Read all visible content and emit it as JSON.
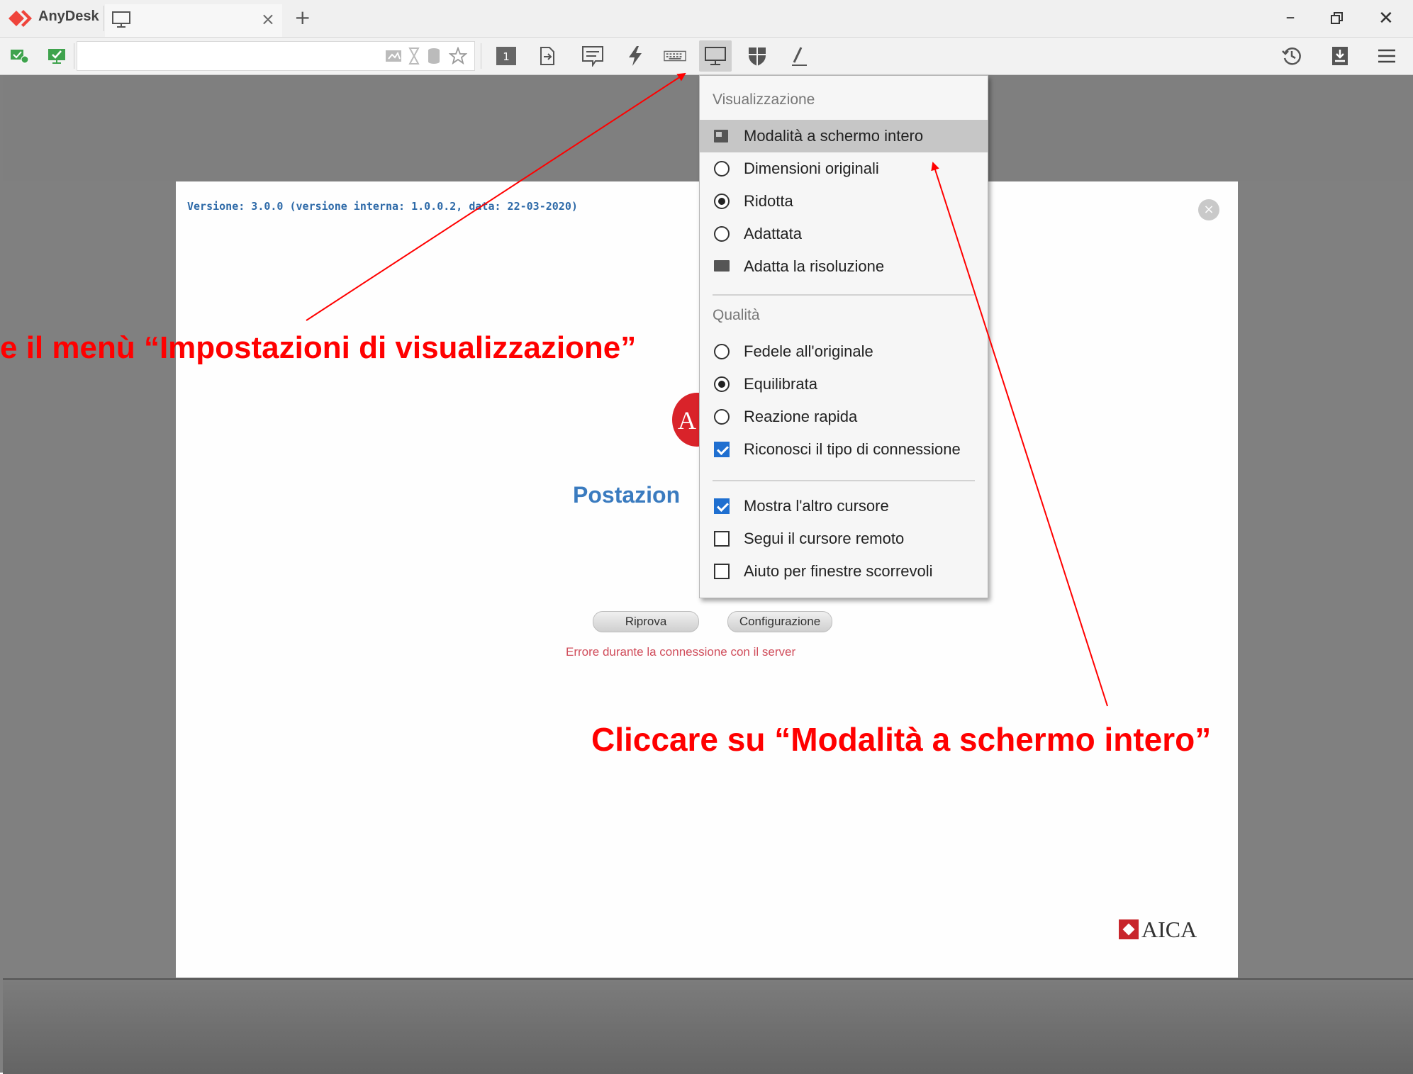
{
  "titlebar": {
    "app_name": "AnyDesk",
    "tab_close": "×",
    "tab_add": "+",
    "minimize": "–",
    "close": "✕"
  },
  "remote": {
    "version_text": "Versione: 3.0.0  (versione interna: 1.0.0.2, data: 22-03-2020)",
    "close_glyph": "×",
    "logo_text": "A",
    "title": "Postazion",
    "retry_button": "Riprova",
    "config_button": "Configurazione",
    "error": "Errore durante la connessione con il server",
    "brand": "AICA"
  },
  "menu": {
    "section_display": "Visualizzazione",
    "fullscreen": "Modalità a schermo intero",
    "original": "Dimensioni originali",
    "reduced": "Ridotta",
    "fitted": "Adattata",
    "adapt_resolution": "Adatta la risoluzione",
    "section_quality": "Qualità",
    "faithful": "Fedele all'originale",
    "balanced": "Equilibrata",
    "fast": "Reazione rapida",
    "detect_connection": "Riconosci il tipo di connessione",
    "show_cursor": "Mostra l'altro cursore",
    "follow_cursor": "Segui il cursore remoto",
    "scroll_help": "Aiuto per finestre scorrevoli"
  },
  "annotations": {
    "left": "e il menù “Impostazioni di visualizzazione”",
    "right": "Cliccare su “Modalità a schermo intero”"
  },
  "colors": {
    "annotation": "#ff0000",
    "accent": "#1f6fd0",
    "brand_red": "#d9232a"
  }
}
